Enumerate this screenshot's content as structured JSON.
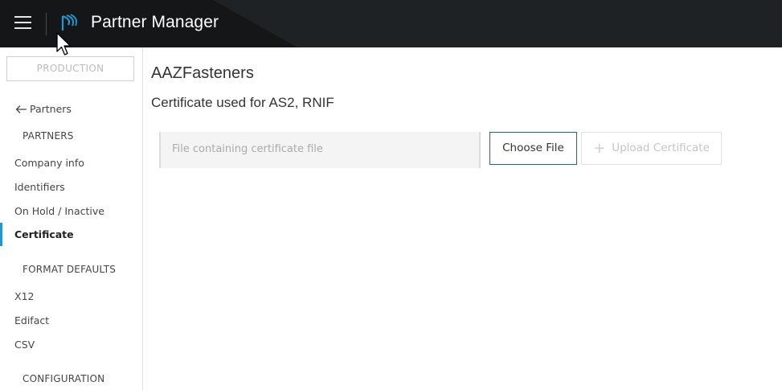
{
  "header": {
    "app_title": "Partner Manager",
    "menu_icon": "hamburger-menu-icon",
    "logo_icon": "partner-manager-logo-icon",
    "colors": {
      "bar": "#1f2224",
      "accent": "#1a9ad6"
    }
  },
  "sidebar": {
    "environment": "PRODUCTION",
    "back_link": "Partners",
    "sections": [
      {
        "heading": "PARTNERS",
        "items": [
          "Company info",
          "Identifiers",
          "On Hold / Inactive",
          "Certificate"
        ]
      },
      {
        "heading": "FORMAT DEFAULTS",
        "items": [
          "X12",
          "Edifact",
          "CSV"
        ]
      },
      {
        "heading": "CONFIGURATION",
        "items": []
      }
    ],
    "active_item": "Certificate"
  },
  "main": {
    "title": "AAZFasteners",
    "subtitle": "Certificate used for AS2, RNIF",
    "file_field_placeholder": "File containing certificate file",
    "choose_file_label": "Choose File",
    "upload_label": "Upload Certificate"
  }
}
